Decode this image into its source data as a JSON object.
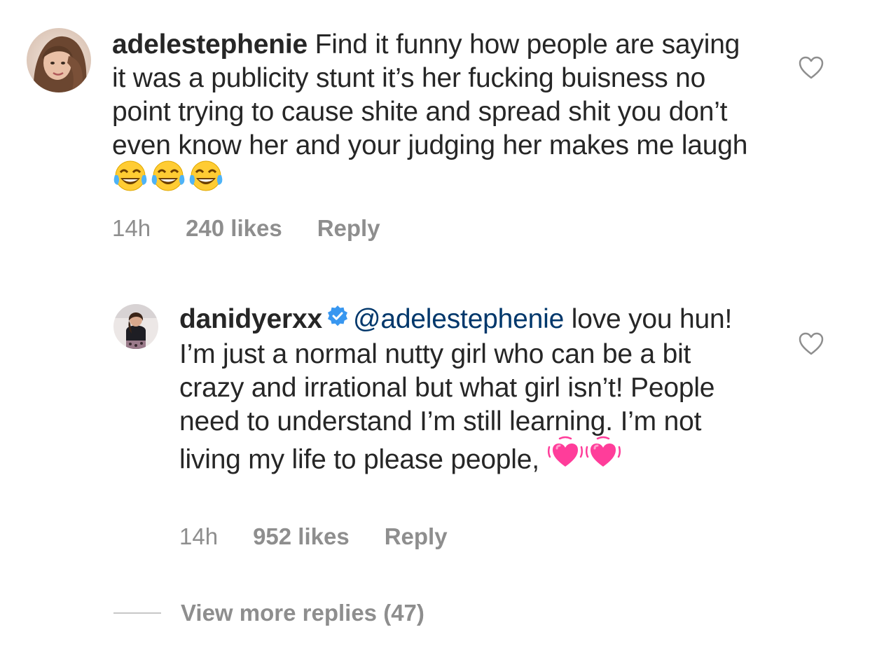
{
  "comments": [
    {
      "username": "adelestephenie",
      "text": "Find it funny how people are saying it was a publicity stunt it’s her fucking buisness no point trying to cause shite and spread shit you don’t even know her and your judging her makes me laugh",
      "emojis": [
        "tears-of-joy-emoji",
        "tears-of-joy-emoji",
        "tears-of-joy-emoji"
      ],
      "time": "14h",
      "likes": "240 likes",
      "reply_label": "Reply"
    }
  ],
  "replies": [
    {
      "username": "danidyerxx",
      "verified": true,
      "mention": "@adelestephenie",
      "text": "love you hun! I’m just a normal nutty girl who can be a bit crazy and irrational but what girl isn’t! People need to understand I’m still learning. I’m not living my life to please people,",
      "emojis": [
        "growing-heart-emoji",
        "growing-heart-emoji"
      ],
      "time": "14h",
      "likes": "952 likes",
      "reply_label": "Reply"
    }
  ],
  "view_more_label": "View more replies (47)",
  "colors": {
    "text": "#262626",
    "meta": "#8e8e8e",
    "mention": "#00376b",
    "verified": "#3897f0",
    "divider": "#c7c7c7"
  }
}
